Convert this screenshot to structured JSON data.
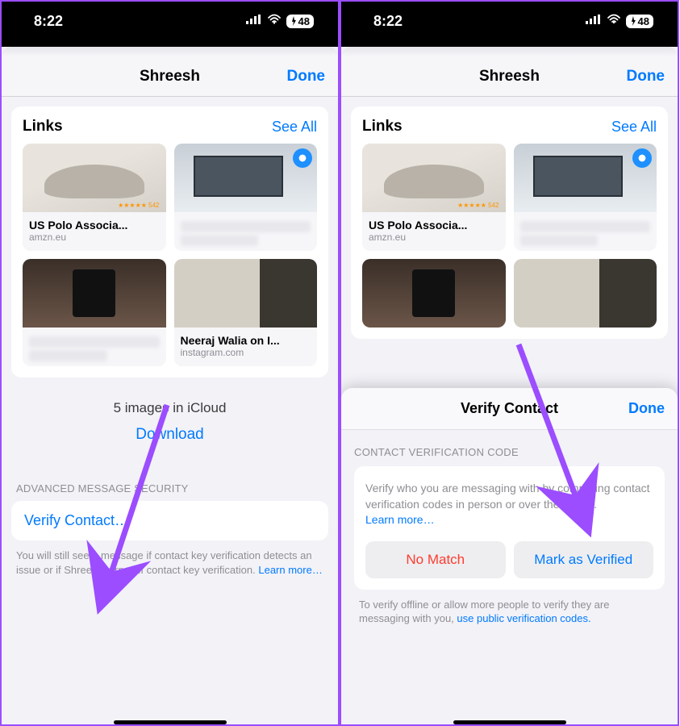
{
  "status": {
    "time": "8:22",
    "battery": "48"
  },
  "nav": {
    "title": "Shreesh",
    "done": "Done"
  },
  "links": {
    "title": "Links",
    "see_all": "See All",
    "items": [
      {
        "title": "US Polo Associa...",
        "domain": "amzn.eu",
        "stars": "★★★★★ 542"
      },
      {
        "title": "",
        "domain": ""
      },
      {
        "title": "",
        "domain": ""
      },
      {
        "title": "Neeraj Walia on I...",
        "domain": "instagram.com"
      }
    ]
  },
  "icloud": {
    "summary": "5 images in iCloud",
    "download": "Download"
  },
  "adv_sec": {
    "header": "ADVANCED MESSAGE SECURITY",
    "verify": "Verify Contact…",
    "footnote": "You will still see a message if contact key verification detects an issue or if Shreesh turns off contact key verification. ",
    "learn_more": "Learn more…"
  },
  "sheet": {
    "title": "Verify Contact",
    "done": "Done",
    "grp_header": "CONTACT VERIFICATION CODE",
    "desc": "Verify who you are messaging with by comparing contact verification codes in person or over the phone. ",
    "learn_more": "Learn more…",
    "no_match": "No Match",
    "mark_verified": "Mark as Verified",
    "footnote": "To verify offline or allow more people to verify they are messaging with you, ",
    "footnote_link": "use public verification codes."
  }
}
